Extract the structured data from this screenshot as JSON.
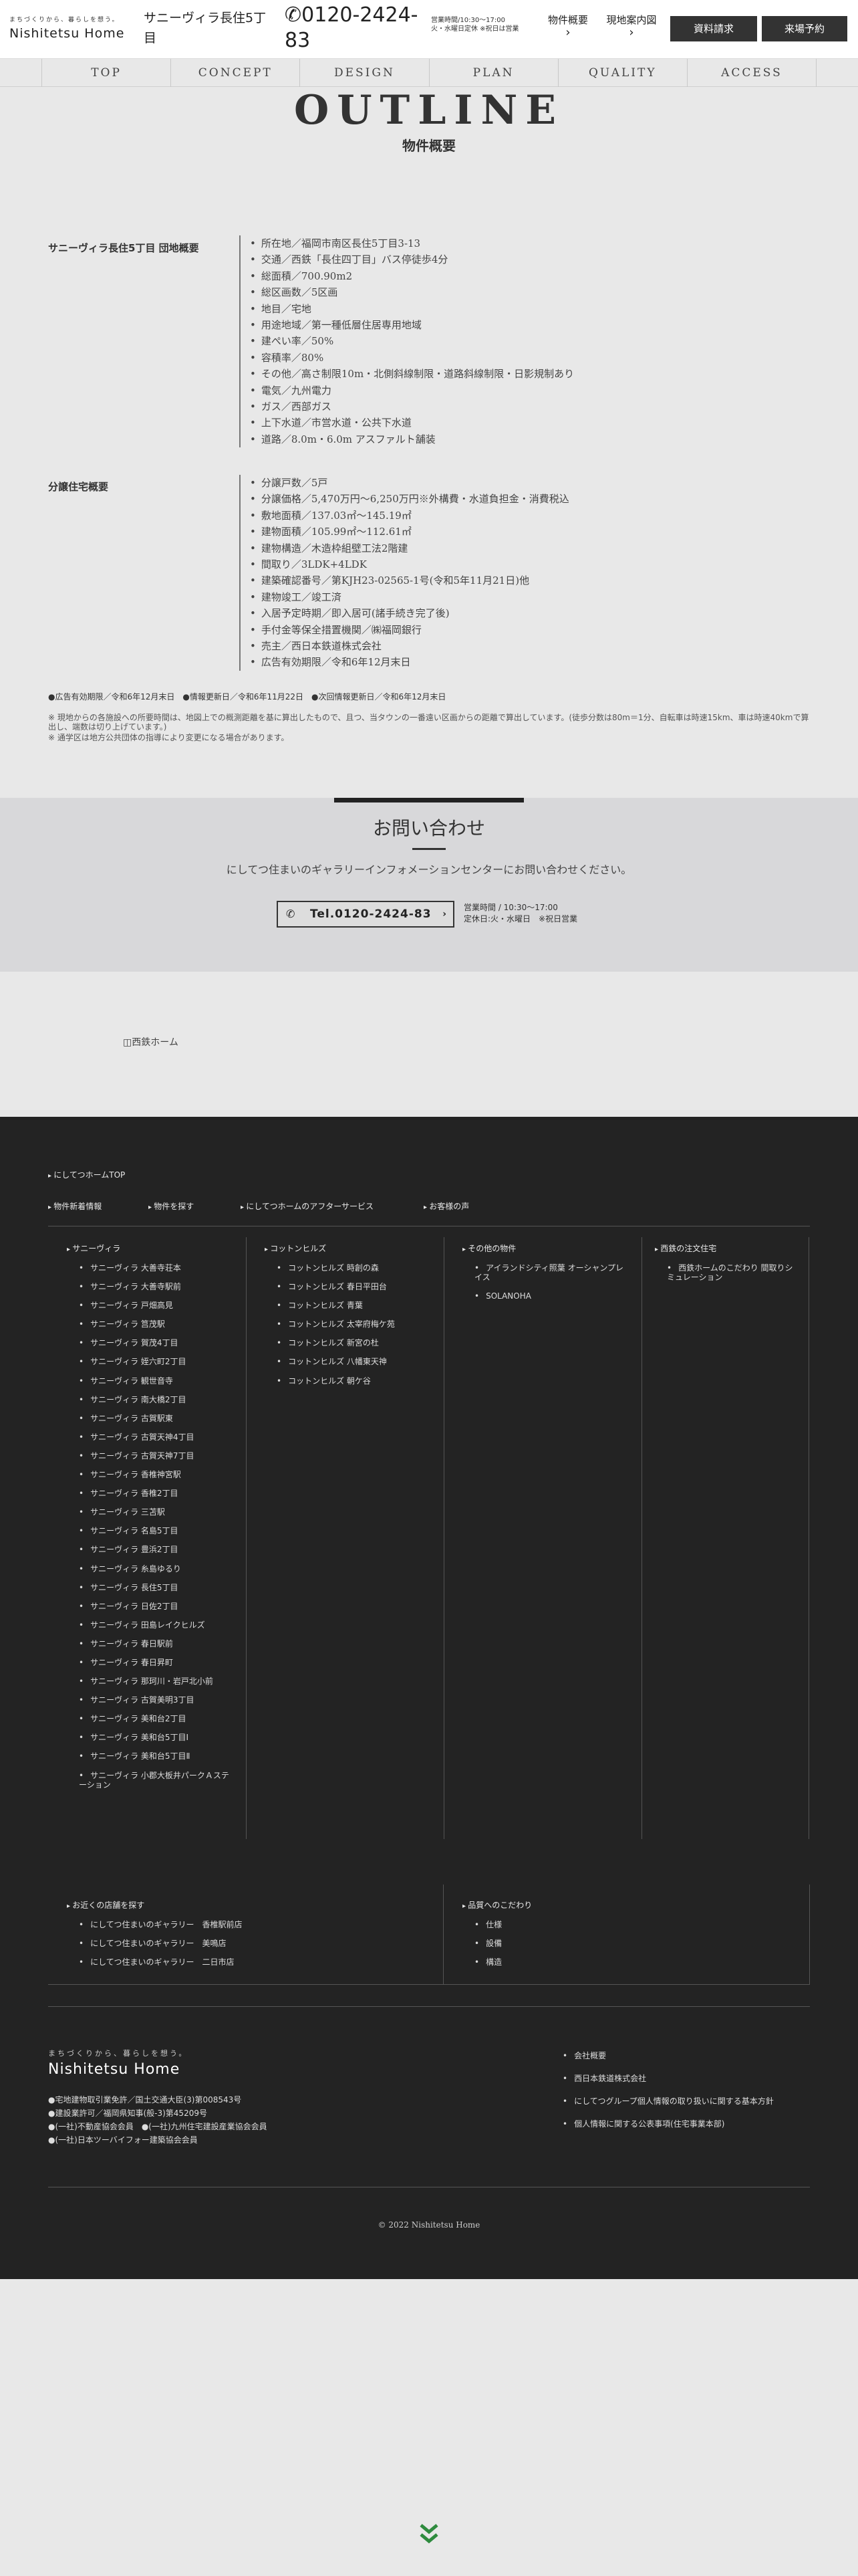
{
  "header": {
    "tagline": "まちづくりから、暮らしを想う。",
    "logo": "Nishitetsu Home",
    "property_name": "サニーヴィラ長住5丁目",
    "phone_icon": "phone-icon",
    "phone": "0120-2424-83",
    "hours_line1": "営業時間/10:30〜17:00",
    "hours_line2": "火・水曜日定休 ※祝日は営業",
    "link_outline": "物件概要",
    "link_map": "現地案内図",
    "btn_request": "資料請求",
    "btn_visit": "来場予約"
  },
  "nav": [
    "TOP",
    "CONCEPT",
    "DESIGN",
    "PLAN",
    "QUALITY",
    "ACCESS"
  ],
  "outline": {
    "title": "OUTLINE",
    "subtitle": "物件概要",
    "section1_label": "サニーヴィラ長住5丁目 団地概要",
    "section1_items": [
      "所在地／福岡市南区長住5丁目3-13",
      "交通／西鉄「長住四丁目」バス停徒歩4分",
      "総面積／700.90m2",
      "総区画数／5区画",
      "地目／宅地",
      "用途地域／第一種低層住居専用地域",
      "建ぺい率／50%",
      "容積率／80%",
      "その他／高さ制限10m・北側斜線制限・道路斜線制限・日影規制あり",
      "電気／九州電力",
      "ガス／西部ガス",
      "上下水道／市営水道・公共下水道",
      "道路／8.0m・6.0m アスファルト舗装"
    ],
    "section2_label": "分譲住宅概要",
    "section2_items": [
      "分譲戸数／5戸",
      "分譲価格／5,470万円〜6,250万円※外構費・水道負担金・消費税込",
      "敷地面積／137.03㎡〜145.19㎡",
      "建物面積／105.99㎡〜112.61㎡",
      "建物構造／木造枠組壁工法2階建",
      "間取り／3LDK+4LDK",
      "建築確認番号／第KJH23-02565-1号(令和5年11月21日)他",
      "建物竣工／竣工済",
      "入居予定時期／即入居可(諸手続き完了後)",
      "手付金等保全措置機関／㈱福岡銀行",
      "売主／西日本鉄道株式会社",
      "広告有効期限／令和6年12月末日"
    ],
    "update_line": "●広告有効期限／令和6年12月末日　●情報更新日／令和6年11月22日　●次回情報更新日／令和6年12月末日",
    "note1": "※ 現地からの各施設への所要時間は、地図上での概測距離を基に算出したもので、且つ、当タウンの一番遠い区画からの距離で算出しています。(徒歩分数は80m＝1分、自転車は時速15km、車は時速40kmで算出し、端数は切り上げています。)",
    "note2": "※ 通学区は地方公共団体の指導により変更になる場合があります。"
  },
  "contact": {
    "title": "お問い合わせ",
    "description": "にしてつ住まいのギャラリーインフォメーションセンターにお問い合わせください。",
    "tel_label": "Tel.0120-2424-83",
    "hours_line1": "営業時間 / 10:30〜17:00",
    "hours_line2": "定休日:火・水曜日　※祝日営業"
  },
  "image_alt": "西鉄ホーム",
  "footer": {
    "top_link": "にしてつホームTOP",
    "links": [
      "物件新着情報",
      "物件を探す",
      "にしてつホームのアフターサービス",
      "お客様の声"
    ],
    "col1_head": "サニーヴィラ",
    "col1_items": [
      "サニーヴィラ 大善寺荘本",
      "サニーヴィラ 大善寺駅前",
      "サニーヴィラ 戸畑高見",
      "サニーヴィラ 筥茂駅",
      "サニーヴィラ 賀茂4丁目",
      "サニーヴィラ 姪六町2丁目",
      "サニーヴィラ 観世音寺",
      "サニーヴィラ 南大橋2丁目",
      "サニーヴィラ 古賀駅東",
      "サニーヴィラ 古賀天神4丁目",
      "サニーヴィラ 古賀天神7丁目",
      "サニーヴィラ 香椎神宮駅",
      "サニーヴィラ 香椎2丁目",
      "サニーヴィラ 三苫駅",
      "サニーヴィラ 名島5丁目",
      "サニーヴィラ 豊浜2丁目",
      "サニーヴィラ 糸島ゆるり",
      "サニーヴィラ 長住5丁目",
      "サニーヴィラ 日佐2丁目",
      "サニーヴィラ 田島レイクヒルズ",
      "サニーヴィラ 春日駅前",
      "サニーヴィラ 春日昇町",
      "サニーヴィラ 那珂川・岩戸北小前",
      "サニーヴィラ 古賀美明3丁目",
      "サニーヴィラ 美和台2丁目",
      "サニーヴィラ 美和台5丁目Ⅰ",
      "サニーヴィラ 美和台5丁目Ⅱ",
      "サニーヴィラ 小郡大板井パークＡステーション"
    ],
    "col2_head": "コットンヒルズ",
    "col2_items": [
      "コットンヒルズ 時創の森",
      "コットンヒルズ 春日平田台",
      "コットンヒルズ 青葉",
      "コットンヒルズ 太宰府梅ケ苑",
      "コットンヒルズ 新宮の杜",
      "コットンヒルズ 八幡東天神",
      "コットンヒルズ 朝ケ谷"
    ],
    "col3_head": "その他の物件",
    "col3_items": [
      "アイランドシティ照葉 オーシャンプレイス",
      "SOLANOHA"
    ],
    "col4_head": "西鉄の注文住宅",
    "col4_items": [
      "西鉄ホームのこだわり 間取りシミュレーション"
    ],
    "shops_head": "お近くの店舗を探す",
    "shops": [
      "にしてつ住まいのギャラリー　香椎駅前店",
      "にしてつ住まいのギャラリー　美鳴店",
      "にしてつ住まいのギャラリー　二日市店"
    ],
    "quality_head": "品質へのこだわり",
    "quality": [
      "仕様",
      "設備",
      "構造"
    ],
    "brand_tagline": "まちづくりから、暮らしを想う。",
    "brand_logo": "Nishitetsu Home",
    "licenses": [
      "●宅地建物取引業免許／国土交通大臣(3)第008543号",
      "●建設業許可／福岡県知事(般-3)第45209号",
      "●(一社)不動産協会会員　●(一社)九州住宅建設産業協会会員",
      "●(一社)日本ツーバイフォー建築協会会員"
    ],
    "right_links": [
      "会社概要",
      "西日本鉄道株式会社",
      "にしてつグループ個人情報の取り扱いに関する基本方針",
      "個人情報に関する公表事項(住宅事業本部)"
    ],
    "copyright": "© 2022 Nishitetsu Home"
  },
  "scroll_icon": "double-chevron-down-icon",
  "colors": {
    "dark": "#232323",
    "accent_green": "#2e8b3e",
    "page_bg": "#e8e8e8"
  }
}
